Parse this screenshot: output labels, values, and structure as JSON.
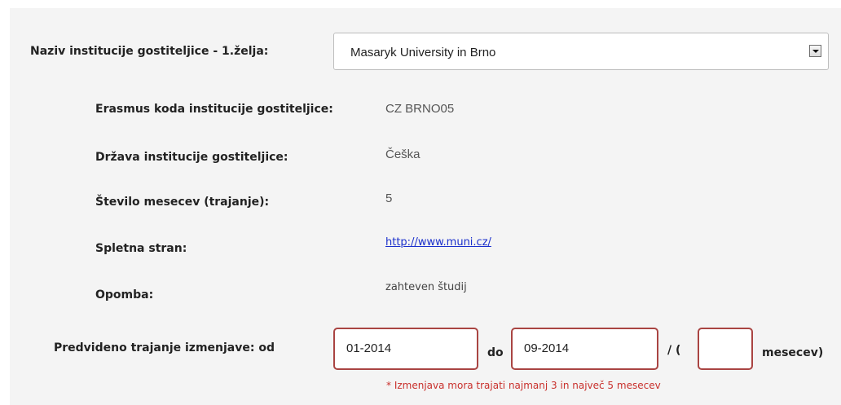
{
  "host_institution": {
    "label": "Naziv institucije gostiteljice - 1.želja:",
    "selected": "Masaryk University in Brno"
  },
  "details": {
    "erasmus_code_label": "Erasmus koda institucije gostiteljice:",
    "erasmus_code_value": "CZ BRNO05",
    "country_label": "Država institucije gostiteljice:",
    "country_value": "Češka",
    "months_label": "Število mesecev (trajanje):",
    "months_value": "5",
    "website_label": "Spletna stran:",
    "website_value": "http://www.muni.cz/",
    "note_label": "Opomba:",
    "note_value": "zahteven študij"
  },
  "duration": {
    "label": "Predvideno trajanje izmenjave: od",
    "from_value": "01-2014",
    "to_label": "do",
    "to_value": "09-2014",
    "separator": "/ (",
    "months_value": "",
    "months_suffix": "mesecev)",
    "error": "* Izmenjava mora trajati najmanj 3 in največ 5 mesecev"
  },
  "colors": {
    "panel_bg": "#f4f4f4",
    "error_border": "#a94442",
    "error_text": "#c9302c",
    "link": "#1a2fcc"
  }
}
